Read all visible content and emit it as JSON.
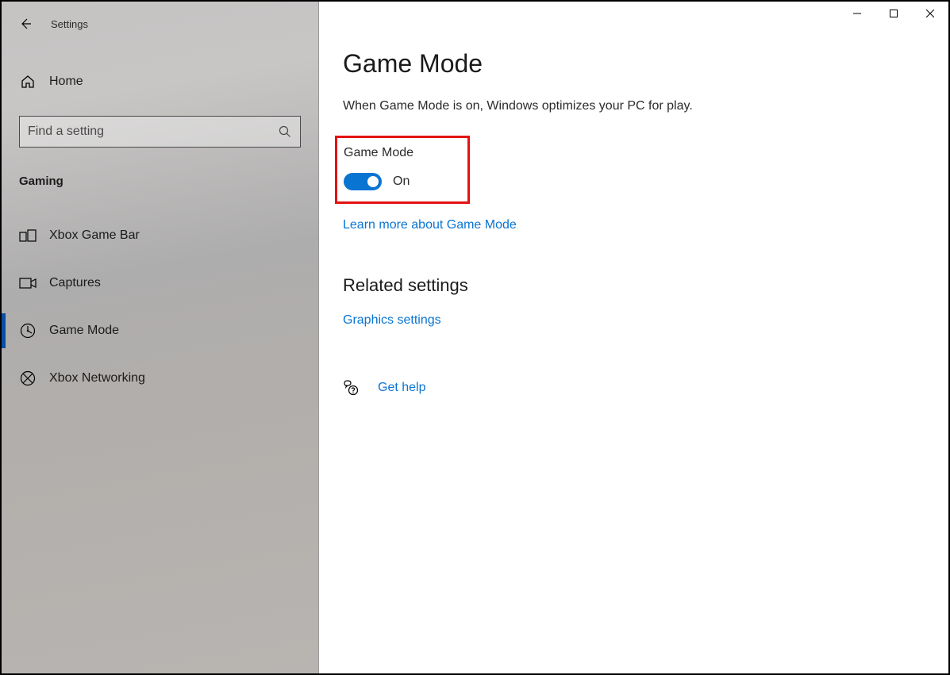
{
  "window": {
    "app_title": "Settings"
  },
  "sidebar": {
    "home_label": "Home",
    "search_placeholder": "Find a setting",
    "category": "Gaming",
    "items": [
      {
        "label": "Xbox Game Bar",
        "icon": "gamebar-icon",
        "active": false
      },
      {
        "label": "Captures",
        "icon": "captures-icon",
        "active": false
      },
      {
        "label": "Game Mode",
        "icon": "gamemode-icon",
        "active": true
      },
      {
        "label": "Xbox Networking",
        "icon": "xbox-icon",
        "active": false
      }
    ]
  },
  "main": {
    "title": "Game Mode",
    "description": "When Game Mode is on, Windows optimizes your PC for play.",
    "game_mode": {
      "label": "Game Mode",
      "state_label": "On"
    },
    "learn_link": "Learn more about Game Mode",
    "related_header": "Related settings",
    "graphics_link": "Graphics settings",
    "help_link": "Get help"
  }
}
